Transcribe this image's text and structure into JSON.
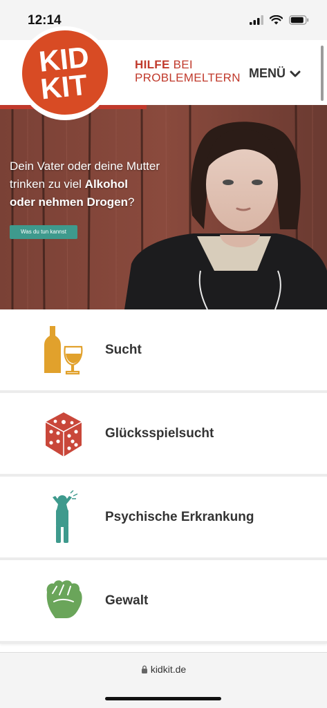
{
  "status": {
    "time": "12:14"
  },
  "header": {
    "logo_line1": "KID",
    "logo_line2": "KIT",
    "tagline_bold": "HILFE",
    "tagline_rest1": " BEI",
    "tagline_line2": "PROBLEMELTERN",
    "menu_label": "MENÜ"
  },
  "hero": {
    "line1": "Dein Vater oder deine Mutter",
    "line2a": "trinken zu viel ",
    "line2b": "Alkohol",
    "line3a": "oder nehmen Drogen",
    "line3b": "?",
    "cta_label": "Was du tun kannst"
  },
  "topics": [
    {
      "label": "Sucht",
      "icon": "bottle-glass-icon",
      "color": "#e1a12c"
    },
    {
      "label": "Glücksspielsucht",
      "icon": "dice-icon",
      "color": "#c9473a"
    },
    {
      "label": "Psychische Erkrankung",
      "icon": "person-headache-icon",
      "color": "#3e9a8d"
    },
    {
      "label": "Gewalt",
      "icon": "fist-icon",
      "color": "#6aa55a"
    }
  ],
  "browser": {
    "url": "kidkit.de"
  },
  "colors": {
    "brand_red": "#c0392b",
    "logo_orange": "#d84b24",
    "teal": "#3e9a8d"
  }
}
